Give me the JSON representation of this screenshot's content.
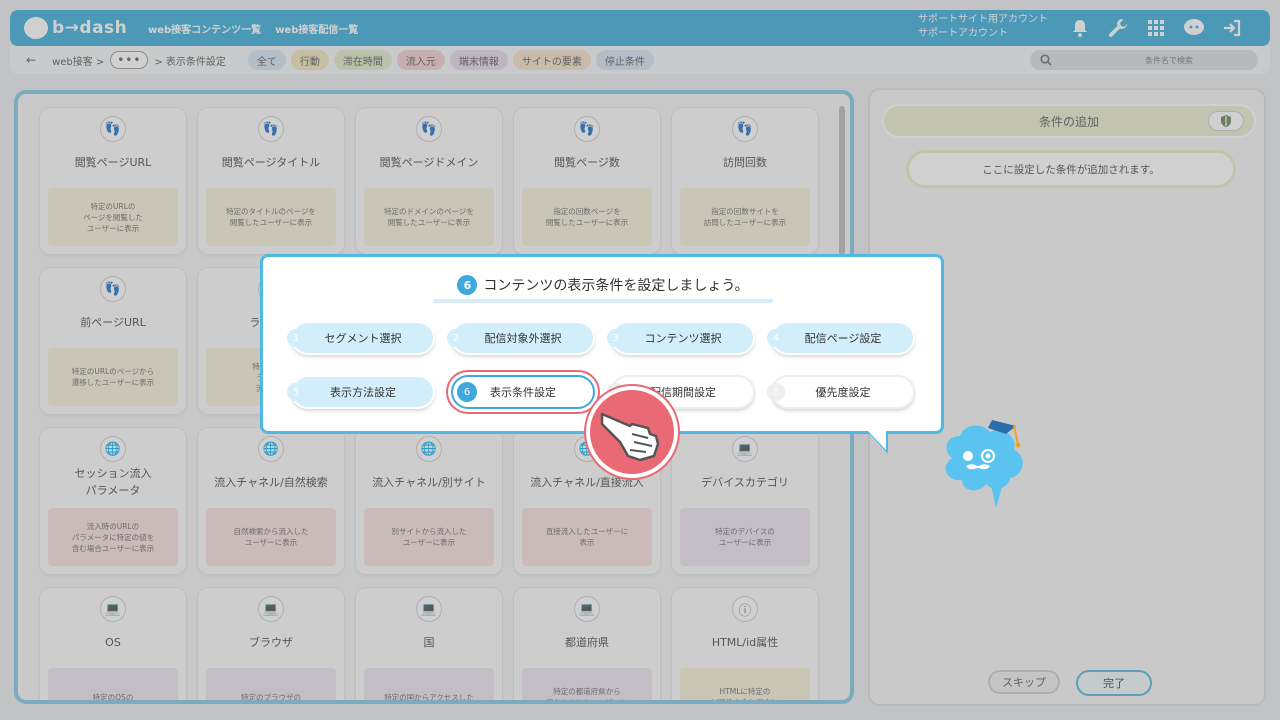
{
  "header": {
    "logo": "b→dash",
    "nav": [
      "web接客コンテンツ一覧",
      "web接客配信一覧"
    ],
    "account_line1": "サポートサイト用アカウント",
    "account_line2": "サポートアカウント",
    "icons": [
      "bell-icon",
      "wrench-icon",
      "grid-icon",
      "chat-icon",
      "logout-icon"
    ]
  },
  "subbar": {
    "back": "←",
    "breadcrumb_root": "web接客 >",
    "more": "•••",
    "breadcrumb_current": "> 表示条件設定",
    "tabs": [
      {
        "label": "全て",
        "color": "#cfe3ef"
      },
      {
        "label": "行動",
        "color": "#eee3b8"
      },
      {
        "label": "滞在時間",
        "color": "#e1e8c6"
      },
      {
        "label": "流入元",
        "color": "#f2cccc"
      },
      {
        "label": "端末情報",
        "color": "#e3d5ea"
      },
      {
        "label": "サイトの要素",
        "color": "#f3dfc4"
      },
      {
        "label": "停止条件",
        "color": "#d6e0ee"
      }
    ],
    "search_placeholder": "条件名で検索"
  },
  "cards": [
    {
      "icon": "footprints-icon",
      "glyph": "👣",
      "title": "閲覧ページURL",
      "desc": "特定のURLの\nページを閲覧した\nユーザーに表示",
      "color": "#f5efd9"
    },
    {
      "icon": "footprints-icon",
      "glyph": "👣",
      "title": "閲覧ページタイトル",
      "desc": "特定のタイトルのページを\n閲覧したユーザーに表示",
      "color": "#f5efd9"
    },
    {
      "icon": "footprints-icon",
      "glyph": "👣",
      "title": "閲覧ページドメイン",
      "desc": "特定のドメインのページを\n閲覧したユーザーに表示",
      "color": "#f5efd9"
    },
    {
      "icon": "footprints-icon",
      "glyph": "👣",
      "title": "閲覧ページ数",
      "desc": "指定の回数ページを\n閲覧したユーザーに表示",
      "color": "#f5efd9"
    },
    {
      "icon": "footprints-icon",
      "glyph": "👣",
      "title": "訪問回数",
      "desc": "指定の回数サイトを\n訪問したユーザーに表示",
      "color": "#f5efd9"
    },
    {
      "icon": "footprints-icon",
      "glyph": "👣",
      "title": "前ページURL",
      "desc": "特定のURLのページから\n遷移したユーザーに表示",
      "color": "#f5efd9"
    },
    {
      "icon": "footprints-icon",
      "glyph": "👣",
      "title": "ランディ",
      "desc": "特定のURL\nランディ\n流入した",
      "color": "#f5efd9"
    },
    {
      "icon": "footprints-icon",
      "glyph": "",
      "title": "",
      "desc": "",
      "color": "#f5efd9"
    },
    {
      "icon": "footprints-icon",
      "glyph": "",
      "title": "",
      "desc": "",
      "color": "#f5efd9"
    },
    {
      "icon": "footprints-icon",
      "glyph": "",
      "title": "",
      "desc": "",
      "color": "#f5efd9"
    },
    {
      "icon": "globe-icon",
      "glyph": "🌐",
      "title": "セッション流入\nパラメータ",
      "desc": "流入時のURLの\nパラメータに特定の値を\n含む場合ユーザーに表示",
      "color": "#f6dede"
    },
    {
      "icon": "globe-icon",
      "glyph": "🌐",
      "title": "流入チャネル/自然検索",
      "desc": "自然検索から流入した\nユーザーに表示",
      "color": "#f6dede"
    },
    {
      "icon": "globe-icon",
      "glyph": "🌐",
      "title": "流入チャネル/別サイト",
      "desc": "別サイトから流入した\nユーザーに表示",
      "color": "#f6dede"
    },
    {
      "icon": "globe-icon",
      "glyph": "🌐",
      "title": "流入チャネル/直接流入",
      "desc": "直接流入したユーザーに\n表示",
      "color": "#f6dede"
    },
    {
      "icon": "laptop-icon",
      "glyph": "💻",
      "title": "デバイスカテゴリ",
      "desc": "特定のデバイスの\nユーザーに表示",
      "color": "#ece2f0"
    },
    {
      "icon": "laptop-icon",
      "glyph": "💻",
      "title": "OS",
      "desc": "特定のOSの",
      "color": "#ece2f0"
    },
    {
      "icon": "laptop-icon",
      "glyph": "💻",
      "title": "ブラウザ",
      "desc": "特定のブラウザの",
      "color": "#ece2f0"
    },
    {
      "icon": "laptop-icon",
      "glyph": "💻",
      "title": "国",
      "desc": "特定の国からアクセスした",
      "color": "#ece2f0"
    },
    {
      "icon": "laptop-icon",
      "glyph": "💻",
      "title": "都道府県",
      "desc": "特定の都道府県から\nアクセスしたユーザーに",
      "color": "#ece2f0"
    },
    {
      "icon": "info-icon",
      "glyph": "ⓘ",
      "title": "HTML/id属性",
      "desc": "HTMLに特定の\nid属性を含む場合に",
      "color": "#f6eed6"
    }
  ],
  "right": {
    "add_header": "条件の追加",
    "add_note": "ここに設定した条件が追加されます。",
    "skip": "スキップ",
    "done": "完了"
  },
  "tutorial": {
    "step_number": "6",
    "title": "コンテンツの表示条件を設定しましょう。",
    "steps": [
      {
        "n": "1",
        "label": "セグメント選択",
        "state": "blue"
      },
      {
        "n": "2",
        "label": "配信対象外選択",
        "state": "blue"
      },
      {
        "n": "3",
        "label": "コンテンツ選択",
        "state": "blue"
      },
      {
        "n": "4",
        "label": "配信ページ設定",
        "state": "blue"
      },
      {
        "n": "5",
        "label": "表示方法設定",
        "state": "blue"
      },
      {
        "n": "6",
        "label": "表示条件設定",
        "state": "active"
      },
      {
        "n": "7",
        "label": "配信期間設定",
        "state": "white"
      },
      {
        "n": "8",
        "label": "優先度設定",
        "state": "white"
      }
    ]
  }
}
